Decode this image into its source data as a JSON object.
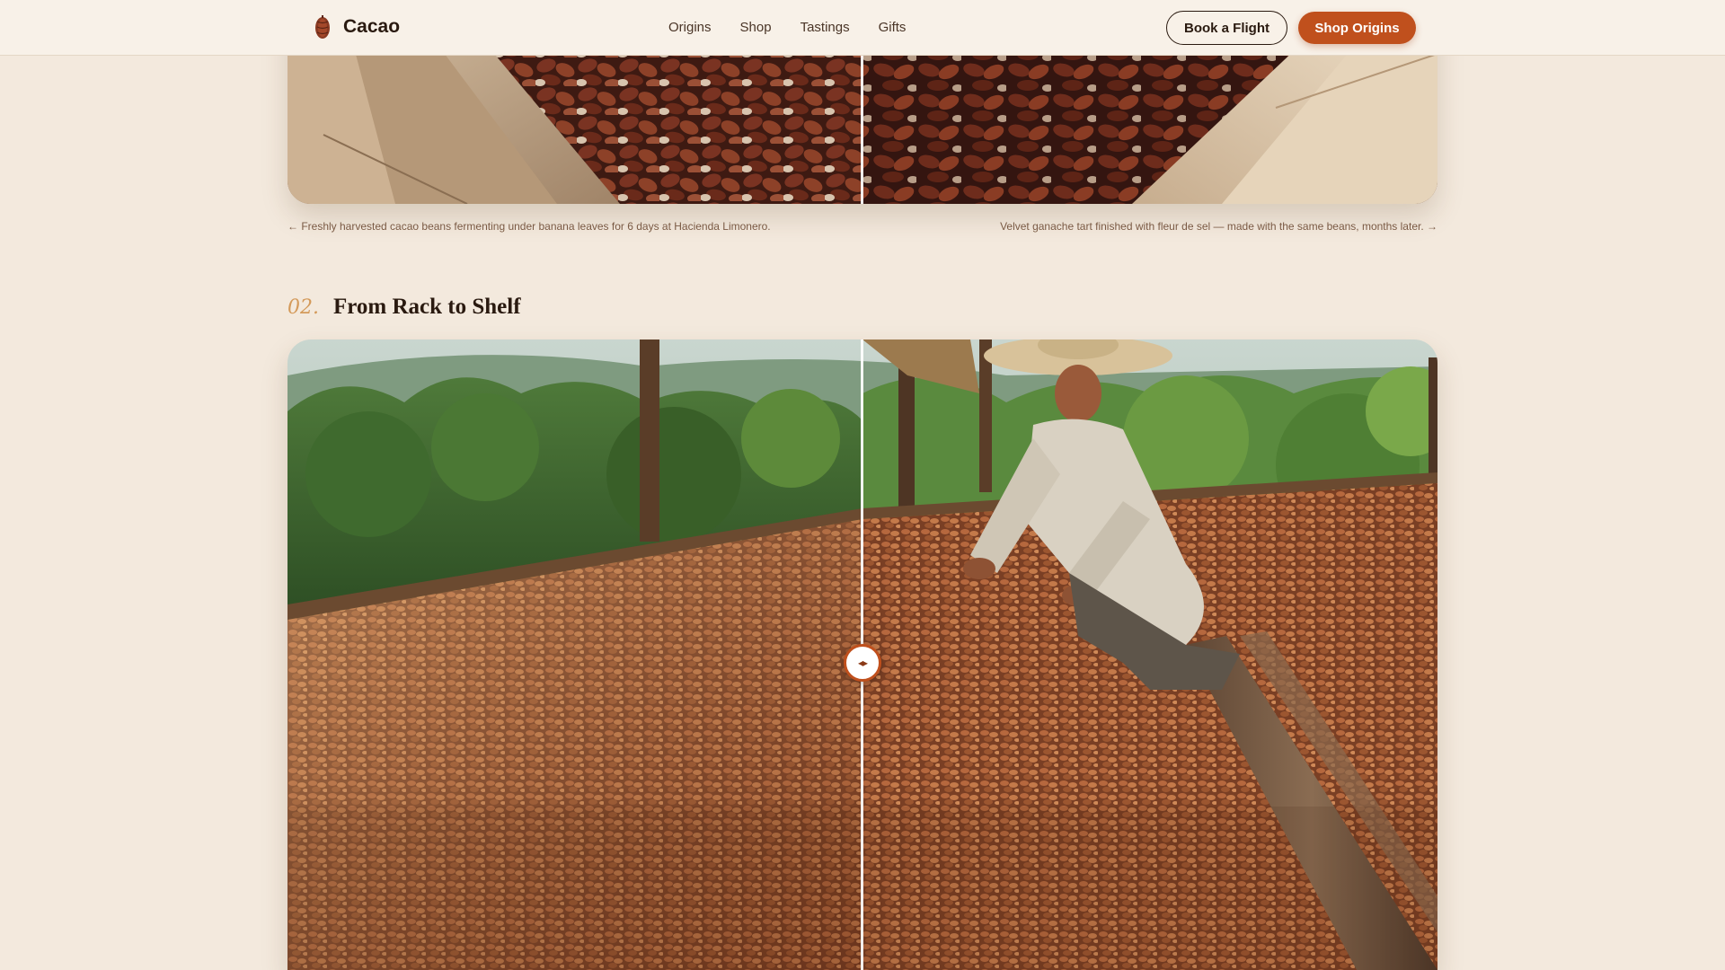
{
  "nav": {
    "brand": "Cacao",
    "links": [
      "Origins",
      "Shop",
      "Tastings",
      "Gifts"
    ],
    "book_label": "Book a Flight",
    "shop_label": "Shop Origins"
  },
  "section1": {
    "caption_left": "← Freshly harvested cacao beans fermenting under banana leaves for 6 days at Hacienda Limonero.",
    "caption_right": "Velvet ganache tart finished with fleur de sel — made with the same beans, months later. →"
  },
  "section2": {
    "number": "02.",
    "title": "From Rack to Shelf",
    "handle_glyph": "◂▸"
  },
  "colors": {
    "background": "#f3e9dd",
    "accent": "#c0501d",
    "section_number": "#d49a5a"
  },
  "icons": {
    "logo": "cacao-pod-icon",
    "handle": "slider-arrows-icon"
  }
}
